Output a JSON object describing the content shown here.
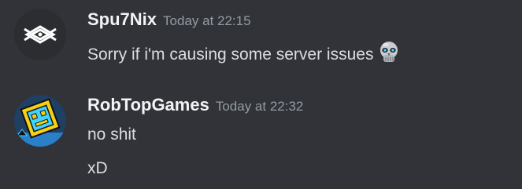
{
  "messages": [
    {
      "username": "Spu7Nix",
      "timestamp": "Today at 22:15",
      "avatar_icon": "spu7nix-logo-icon",
      "lines": [
        {
          "text": "Sorry if i'm causing some server issues",
          "emoji": "robot-skull-emoji-icon"
        }
      ]
    },
    {
      "username": "RobTopGames",
      "timestamp": "Today at 22:32",
      "avatar_icon": "geometry-dash-cube-icon",
      "lines": [
        {
          "text": "no shit"
        },
        {
          "text": "xD"
        }
      ]
    }
  ],
  "colors": {
    "background": "#313338",
    "username": "#f2f3f5",
    "timestamp": "#949ba4",
    "message_text": "#dbdee1",
    "cube_yellow": "#f5d016",
    "cube_cyan": "#3fd3ff"
  }
}
